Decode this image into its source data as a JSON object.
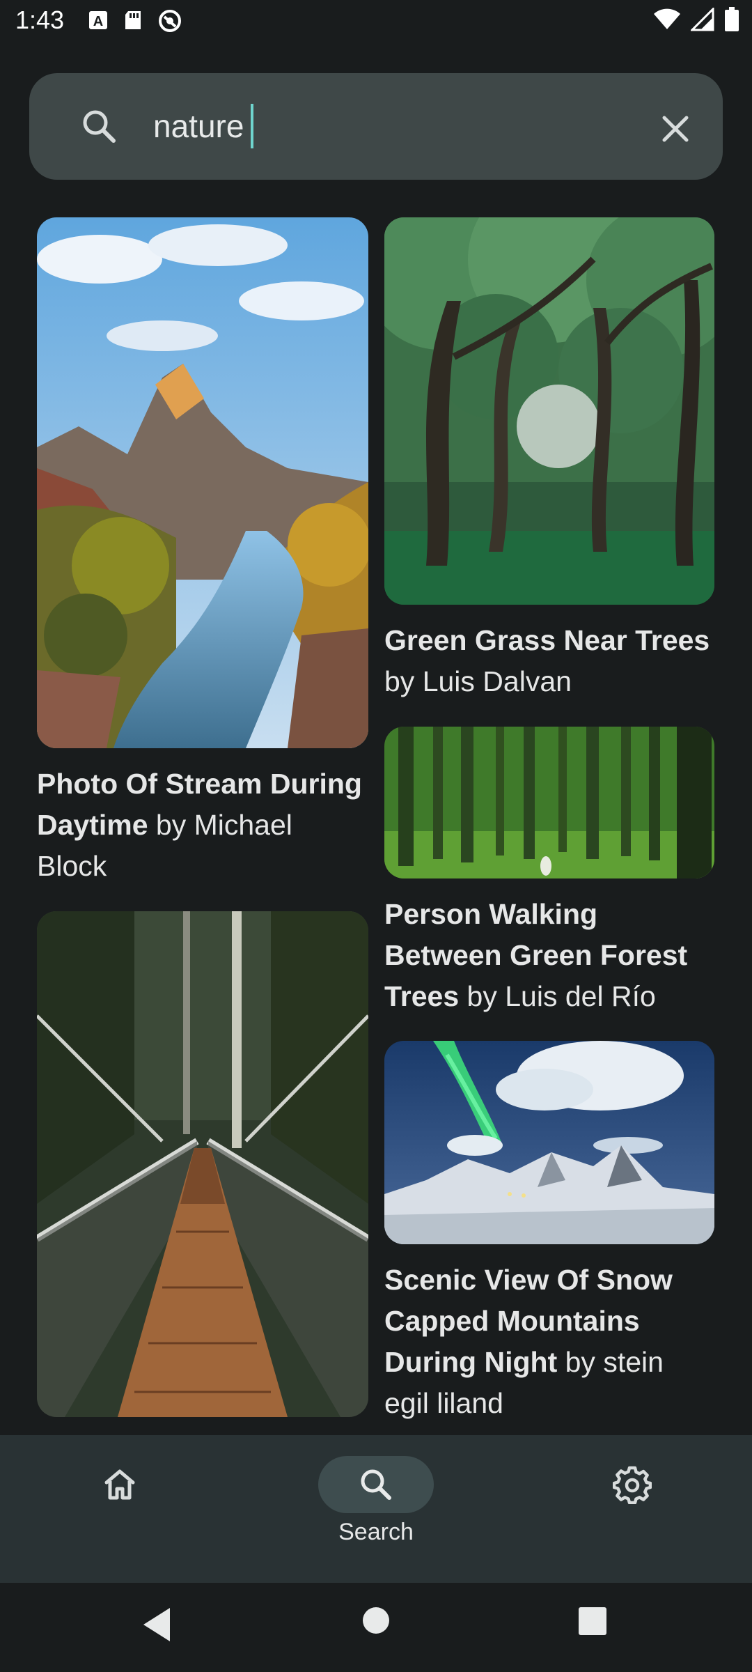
{
  "status_bar": {
    "time": "1:43",
    "left_icons": [
      "a-icon",
      "sd-card-icon",
      "vpn-icon"
    ],
    "right_icons": [
      "wifi-icon",
      "signal-icon",
      "battery-icon"
    ]
  },
  "search": {
    "query": "nature",
    "placeholder": "Search"
  },
  "results": [
    {
      "title": "Photo Of Stream During Daytime",
      "by": " by ",
      "author": "Michael Block",
      "image": "stream-canyon-photo"
    },
    {
      "title": "Green Grass Near Trees",
      "by": " by ",
      "author": "Luis Dalvan",
      "image": "green-trees-photo"
    },
    {
      "title": "Person Walking Between Green Forest Trees",
      "by": " by ",
      "author": "Luis del Río",
      "image": "green-forest-photo"
    },
    {
      "title": "Scenic View Of Snow Capped Mountains During Night",
      "by": " by ",
      "author": "stein egil liland",
      "image": "aurora-mountains-photo"
    },
    {
      "title": "",
      "by": "",
      "author": "",
      "image": "suspension-bridge-photo"
    }
  ],
  "bottom_nav": {
    "items": [
      {
        "label": "",
        "icon": "home-icon",
        "active": false
      },
      {
        "label": "Search",
        "icon": "search-icon",
        "active": true
      },
      {
        "label": "",
        "icon": "gear-icon",
        "active": false
      }
    ]
  },
  "colors": {
    "background": "#191c1d",
    "search_bar": "#3f4848",
    "caret": "#6fd5ce",
    "nav_background": "#293234",
    "nav_active_pill": "#3e4d4f"
  }
}
